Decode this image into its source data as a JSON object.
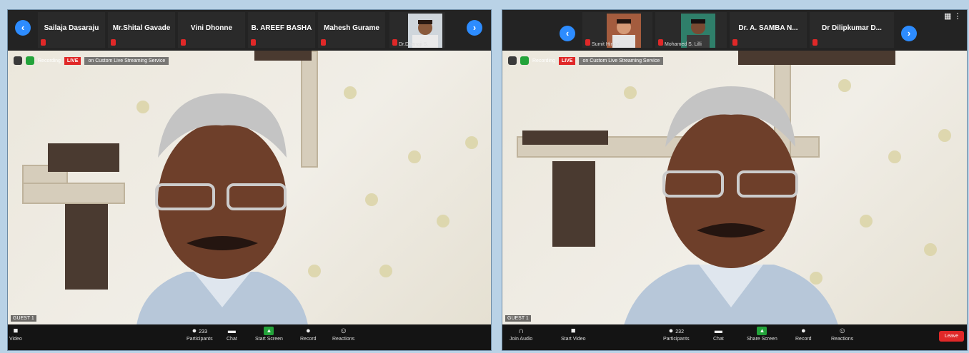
{
  "left": {
    "participants": [
      "Sailaja Dasaraju",
      "Mr.Shital Gavade",
      "Vini Dhonne",
      "B. AREEF BASHA",
      "Mahesh Gurame"
    ],
    "face_tile_label": "Dr.Dhanaji S.",
    "recording": "Recording",
    "live": "LIVE",
    "stream": "on Custom Live Streaming Service",
    "subtitle": "GUEST 1",
    "toolbar": {
      "video": "Video",
      "participants": "Participants",
      "participants_count": "233",
      "chat": "Chat",
      "share": "Start Screen",
      "record": "Record",
      "reactions": "Reactions"
    }
  },
  "right": {
    "face_tiles": [
      "Sumit Hingal",
      "Mohamed S. Lilli"
    ],
    "participants": [
      "Dr. A. SAMBA N...",
      "Dr Dilipkumar D..."
    ],
    "recording": "Recording",
    "live": "LIVE",
    "stream": "on Custom Live Streaming Service",
    "subtitle": "GUEST 1",
    "toolbar": {
      "audio": "Join Audio",
      "video": "Start Video",
      "participants": "Participants",
      "participants_count": "232",
      "chat": "Chat",
      "share": "Share Screen",
      "record": "Record",
      "reactions": "Reactions",
      "end": "Leave"
    }
  },
  "colors": {
    "accent": "#2d8cff",
    "live": "#e02828",
    "share": "#23a33a"
  },
  "icons": [
    "chevron-left-icon",
    "chevron-right-icon",
    "mic-muted-icon",
    "video-icon",
    "participants-icon",
    "chat-icon",
    "share-screen-icon",
    "record-icon",
    "reactions-icon",
    "headphones-icon",
    "gallery-view-icon"
  ]
}
